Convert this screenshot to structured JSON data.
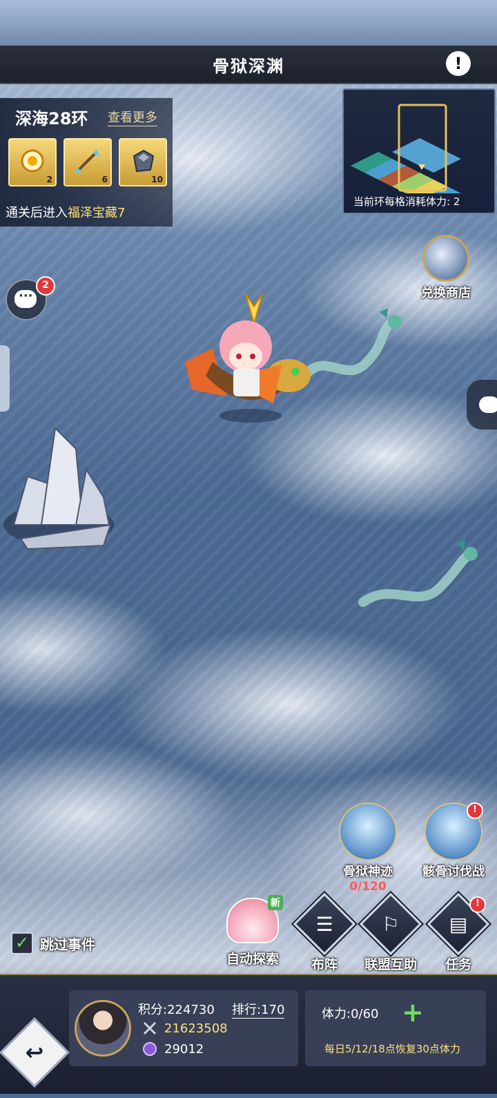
{
  "header": {
    "title": "骨狱深渊",
    "info_icon": "info-icon"
  },
  "stage": {
    "name": "深海28环",
    "view_more": "查看更多",
    "rewards": [
      {
        "icon": "gold-orb-icon",
        "count": "2"
      },
      {
        "icon": "arrow-icon",
        "count": "6"
      },
      {
        "icon": "ore-icon",
        "count": "10"
      }
    ],
    "unlock_prefix": "通关后进入",
    "unlock_target": "福泽宝藏7"
  },
  "minimap": {
    "label": "当前环每格消耗体力:",
    "cost": "2"
  },
  "shop": {
    "label": "兑换商店"
  },
  "chat": {
    "badge": "2"
  },
  "features": {
    "relic": {
      "label": "骨狱神迹",
      "progress": "0/120"
    },
    "battle": {
      "label": "骸骨讨伐战",
      "badge": "!"
    }
  },
  "actions": {
    "auto": {
      "label": "自动探索",
      "tag": "新"
    },
    "formation": {
      "label": "布阵"
    },
    "alliance": {
      "label": "联盟互助"
    },
    "tasks": {
      "label": "任务",
      "badge": "!"
    }
  },
  "skip": {
    "label": "跳过事件",
    "checked": true
  },
  "player": {
    "score": "积分:224730",
    "rank": "排行:170",
    "power": "21623508",
    "gems": "29012"
  },
  "stamina": {
    "value": "体力:0/60",
    "plus": "+",
    "regen": "每日5/12/18点恢复30点体力"
  },
  "colors": {
    "accent_gold": "#ffe27a",
    "alert_red": "#e0393b",
    "progress_red": "#ff5a5a",
    "plus_green": "#6fe05b"
  }
}
